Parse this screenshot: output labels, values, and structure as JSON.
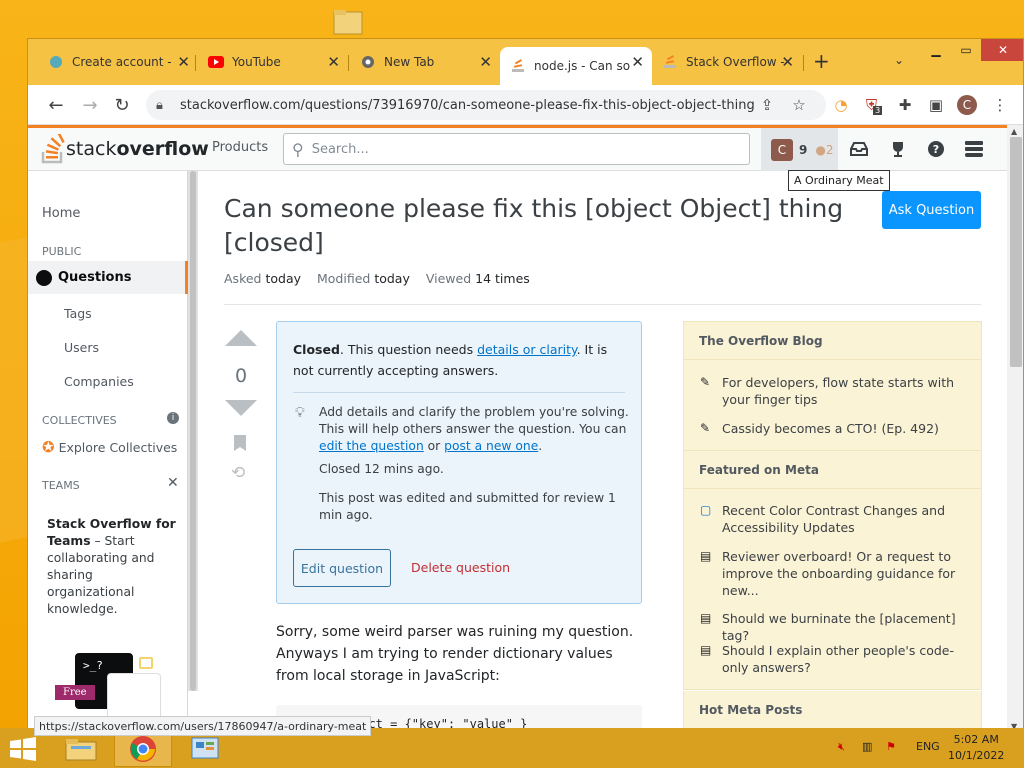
{
  "browser": {
    "tabs": [
      {
        "title": "Create account -",
        "icon": "create-account-favicon"
      },
      {
        "title": "YouTube",
        "icon": "youtube-favicon"
      },
      {
        "title": "New Tab",
        "icon": "chrome-favicon"
      },
      {
        "title": "node.js - Can so",
        "icon": "stackoverflow-favicon",
        "active": true
      },
      {
        "title": "Stack Overflow -",
        "icon": "stackoverflow-favicon"
      }
    ],
    "url": "stackoverflow.com/questions/73916970/can-someone-please-fix-this-object-object-thing",
    "profile_initial": "C",
    "ext_badge": "3",
    "status_url": "https://stackoverflow.com/users/17860947/a-ordinary-meat"
  },
  "so": {
    "logo_stack": "stack",
    "logo_overflow": "overflow",
    "products": "Products",
    "search_placeholder": "Search...",
    "user_initial": "C",
    "reputation": "9",
    "bronze": "●2",
    "tooltip": "A Ordinary Meat"
  },
  "nav": {
    "home": "Home",
    "public": "PUBLIC",
    "questions": "Questions",
    "tags": "Tags",
    "users": "Users",
    "companies": "Companies",
    "collectives": "COLLECTIVES",
    "explore": "Explore Collectives",
    "teams": "TEAMS",
    "teams_title": "Stack Overflow for Teams",
    "teams_text": " – Start collaborating and sharing organizational knowledge.",
    "free": "Free",
    "prompt": ">_?"
  },
  "question": {
    "title": "Can someone please fix this [object Object] thing [closed]",
    "ask_button": "Ask Question",
    "asked_label": "Asked",
    "asked_value": "today",
    "modified_label": "Modified",
    "modified_value": "today",
    "viewed_label": "Viewed",
    "viewed_value": "14 times",
    "votes": "0",
    "body": "Sorry, some weird parser was ruining my question. Anyways I am trying to render dictionary values from local storage in JavaScript:",
    "code": "ject   = {\"key\": \"value\" }"
  },
  "notice": {
    "closed": "Closed",
    "text_a": ". This question needs ",
    "link1": "details or clarity",
    "text_b": ". It is not currently accepting answers.",
    "add_details": "Add details and clarify the problem you're solving. This will help others answer the question. You can ",
    "link2": "edit the question",
    "or": " or ",
    "link3": "post a new one",
    "period": ".",
    "closed_time": "Closed 12 mins ago.",
    "edited": "This post was edited and submitted for review 1 min ago.",
    "edit_btn": "Edit question",
    "delete_btn": "Delete question"
  },
  "sidebar": {
    "blog_title": "The Overflow Blog",
    "blog_items": [
      "For developers, flow state starts with your finger tips",
      "Cassidy becomes a CTO! (Ep. 492)"
    ],
    "meta_title": "Featured on Meta",
    "meta_items": [
      "Recent Color Contrast Changes and Accessibility Updates",
      "Reviewer overboard! Or a request to improve the onboarding guidance for new...",
      "Should we burninate the [placement] tag?",
      "Should I explain other people's code-only answers?"
    ],
    "hot_title": "Hot Meta Posts"
  },
  "taskbar": {
    "lang": "ENG",
    "time": "5:02 AM",
    "date": "10/1/2022"
  },
  "colors": {
    "accent": "#f48024",
    "link": "#0074cc",
    "button": "#0a95ff"
  }
}
